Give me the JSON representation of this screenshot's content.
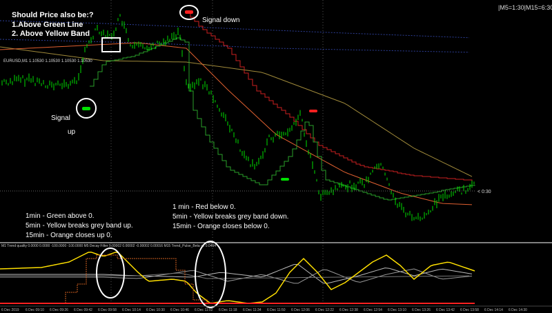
{
  "window": {
    "symbol_header": "EURUSD,M1  1.10530 1.10530 1.10530 1.10530",
    "timeframe_info": "|M5=1:30|M15=6:30"
  },
  "annotations": {
    "title": "Should Price also be:?",
    "point_1": "1.Above Green Line",
    "point_2": "2. Above Yellow Band",
    "signal_down": "Signal down",
    "signal_up_1": "Signal",
    "signal_up_2": "up",
    "up_notes": [
      "1min - Green above 0.",
      "5min - Yellow breaks grey band up.",
      "15min - Orange closes up 0."
    ],
    "down_notes": [
      "1 min - Red below 0.",
      "5min - Yellow breaks grey band down.",
      "15min - Orange closes below 0."
    ],
    "price_label": "< 0:30"
  },
  "indicator_header": "M1 Trend quality 0.0000 0.0000 -100.0000 -100.0000   M5 Decay Filter 0.00002 0.00002 -0.00002 0.00016   M15 Trend_Pulse_Beta v2  0.0454",
  "time_axis": [
    "6 Dec 2019",
    "6 Dec 09:10",
    "6 Dec 09:26",
    "6 Dec 09:42",
    "6 Dec 09:58",
    "6 Dec 10:14",
    "6 Dec 10:30",
    "6 Dec 10:46",
    "6 Dec 11:02",
    "6 Dec 11:18",
    "6 Dec 11:34",
    "6 Dec 11:50",
    "6 Dec 12:06",
    "6 Dec 12:22",
    "6 Dec 12:38",
    "6 Dec 12:54",
    "6 Dec 13:10",
    "6 Dec 13:26",
    "6 Dec 13:42",
    "6 Dec 13:58",
    "6 Dec 14:14",
    "6 Dec 14:30"
  ],
  "colors": {
    "background": "#000000",
    "candles": "#00e000",
    "green_line": "#2aa02a",
    "red_line": "#cc2020",
    "orange_line": "#e06030",
    "yellow_band": "#a08a3a",
    "grey_band": "#2d3f99",
    "oscillator_yellow": "#ffe000",
    "oscillator_grey": "#bbbbbb",
    "separator": "#ffffff"
  }
}
